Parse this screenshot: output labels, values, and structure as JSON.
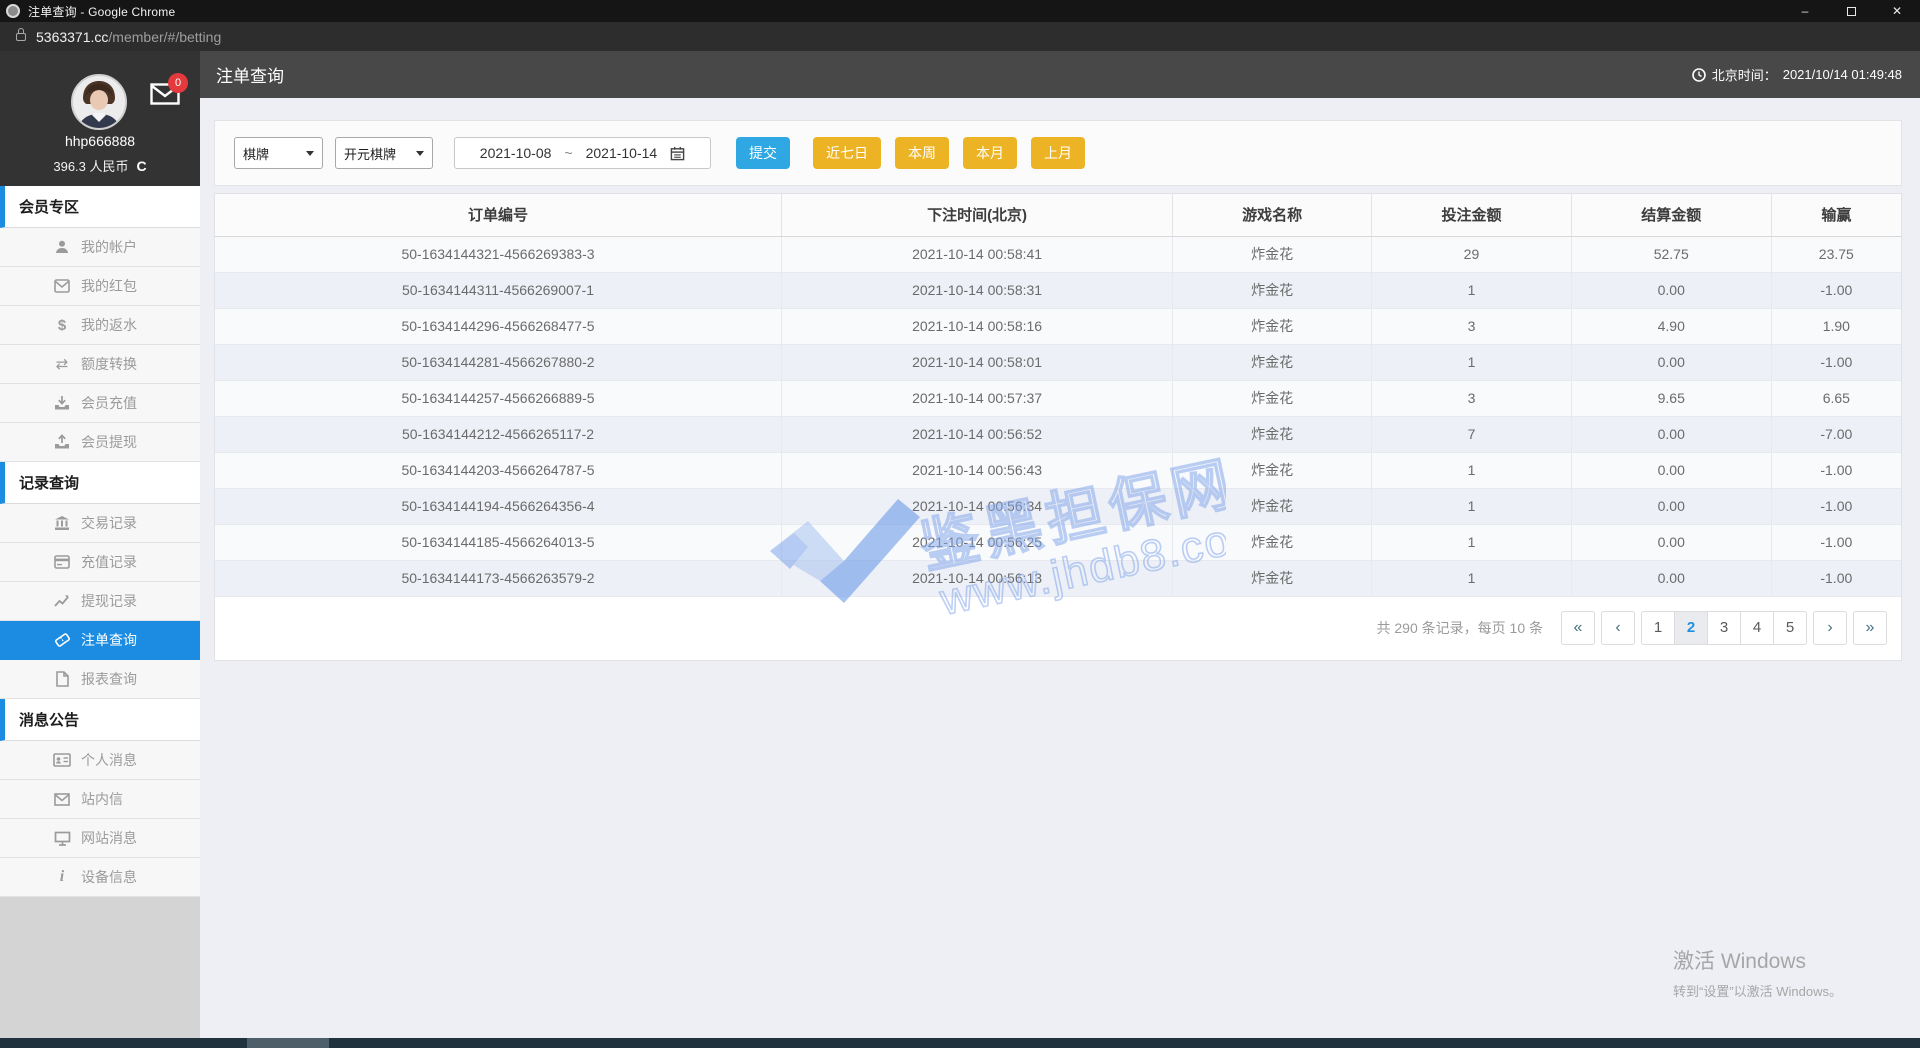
{
  "browser": {
    "title": "注单查询 - Google Chrome",
    "url_domain": "5363371.cc",
    "url_path": "/member/#/betting",
    "minimize": "–",
    "close": "✕"
  },
  "profile": {
    "username": "hhp666888",
    "balance": "396.3 人民币",
    "badge": "0",
    "refresh_glyph": "C"
  },
  "sidebar": {
    "sections": [
      {
        "label": "会员专区",
        "items": [
          {
            "icon": "user-icon",
            "label": "我的帐户"
          },
          {
            "icon": "red-packet-icon",
            "label": "我的红包"
          },
          {
            "icon": "dollar-icon",
            "label": "我的返水"
          },
          {
            "icon": "swap-icon",
            "label": "额度转换"
          },
          {
            "icon": "deposit-icon",
            "label": "会员充值"
          },
          {
            "icon": "withdraw-icon",
            "label": "会员提现"
          }
        ]
      },
      {
        "label": "记录查询",
        "items": [
          {
            "icon": "bank-icon",
            "label": "交易记录"
          },
          {
            "icon": "card-icon",
            "label": "充值记录"
          },
          {
            "icon": "chart-icon",
            "label": "提现记录"
          },
          {
            "icon": "ticket-icon",
            "label": "注单查询",
            "active": true
          },
          {
            "icon": "report-icon",
            "label": "报表查询"
          }
        ]
      },
      {
        "label": "消息公告",
        "items": [
          {
            "icon": "idcard-icon",
            "label": "个人消息"
          },
          {
            "icon": "mail-icon",
            "label": "站内信"
          },
          {
            "icon": "monitor-icon",
            "label": "网站消息"
          },
          {
            "icon": "info-icon",
            "label": "设备信息"
          }
        ]
      }
    ]
  },
  "header": {
    "title": "注单查询",
    "time_label": "北京时间：",
    "time_value": "2021/10/14 01:49:48"
  },
  "filters": {
    "category": "棋牌",
    "provider": "开元棋牌",
    "date_from": "2021-10-08",
    "date_separator": "~",
    "date_to": "2021-10-14",
    "submit": "提交",
    "quick": [
      "近七日",
      "本周",
      "本月",
      "上月"
    ]
  },
  "table": {
    "columns": [
      "订单编号",
      "下注时间(北京)",
      "游戏名称",
      "投注金额",
      "结算金额",
      "输赢"
    ],
    "rows": [
      [
        "50-1634144321-4566269383-3",
        "2021-10-14 00:58:41",
        "炸金花",
        "29",
        "52.75",
        "23.75"
      ],
      [
        "50-1634144311-4566269007-1",
        "2021-10-14 00:58:31",
        "炸金花",
        "1",
        "0.00",
        "-1.00"
      ],
      [
        "50-1634144296-4566268477-5",
        "2021-10-14 00:58:16",
        "炸金花",
        "3",
        "4.90",
        "1.90"
      ],
      [
        "50-1634144281-4566267880-2",
        "2021-10-14 00:58:01",
        "炸金花",
        "1",
        "0.00",
        "-1.00"
      ],
      [
        "50-1634144257-4566266889-5",
        "2021-10-14 00:57:37",
        "炸金花",
        "3",
        "9.65",
        "6.65"
      ],
      [
        "50-1634144212-4566265117-2",
        "2021-10-14 00:56:52",
        "炸金花",
        "7",
        "0.00",
        "-7.00"
      ],
      [
        "50-1634144203-4566264787-5",
        "2021-10-14 00:56:43",
        "炸金花",
        "1",
        "0.00",
        "-1.00"
      ],
      [
        "50-1634144194-4566264356-4",
        "2021-10-14 00:56:34",
        "炸金花",
        "1",
        "0.00",
        "-1.00"
      ],
      [
        "50-1634144185-4566264013-5",
        "2021-10-14 00:56:25",
        "炸金花",
        "1",
        "0.00",
        "-1.00"
      ],
      [
        "50-1634144173-4566263579-2",
        "2021-10-14 00:56:13",
        "炸金花",
        "1",
        "0.00",
        "-1.00"
      ]
    ]
  },
  "pagination": {
    "summary": "共 290 条记录，每页 10 条",
    "first": "«",
    "prev": "‹",
    "pages": [
      "1",
      "2",
      "3",
      "4",
      "5"
    ],
    "active_page": "2",
    "next": "›",
    "last": "»"
  },
  "watermark": {
    "line1": "鉴黑担保网",
    "line2": "www.jhdb8.com"
  },
  "activate": {
    "line1": "激活 Windows",
    "line2": "转到“设置”以激活 Windows。"
  },
  "colors": {
    "accent_blue": "#1b8ce2",
    "submit_blue": "#2ea7e3",
    "quick_yellow": "#ecb424",
    "badge_red": "#e43a3d",
    "watermark_blue": "#8fb0ea"
  }
}
